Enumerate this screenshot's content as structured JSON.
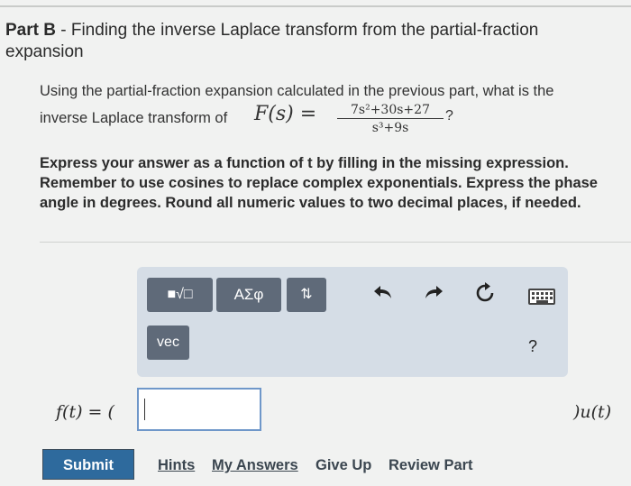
{
  "header": {
    "part_label": "Part B",
    "title_rest": " - Finding the inverse Laplace transform from the partial-fraction expansion"
  },
  "question": {
    "line1": "Using the partial-fraction expansion calculated in the previous part, what is the",
    "line2_prefix": "inverse Laplace transform of",
    "function_label": "F(s) =",
    "numerator": "7s²+30s+27",
    "denominator": "s³+9s",
    "suffix": "?"
  },
  "instructions": {
    "text": "Express your answer as a function of t by filling in the missing expression. Remember to use cosines to replace complex exponentials. Express the phase angle in degrees. Round all numeric values to two decimal places, if needed."
  },
  "toolbar": {
    "templates_label": "■√□",
    "greek_label": "ΑΣφ",
    "arrows_label": "⇅",
    "vec_label": "vec",
    "help_label": "?",
    "icons": [
      "undo-icon",
      "redo-icon",
      "reset-icon",
      "keyboard-icon"
    ]
  },
  "answer": {
    "left_label": "f(t) = (",
    "input_value": "",
    "right_label": ")u(t)"
  },
  "actions": {
    "submit": "Submit",
    "hints": "Hints",
    "my_answers": "My Answers",
    "give_up": "Give Up",
    "review_part": "Review Part"
  },
  "colors": {
    "submit_bg": "#2e6a9d",
    "toolbar_bg": "#d5dde6",
    "tool_button": "#5f6a79",
    "input_border": "#6f97c9"
  }
}
